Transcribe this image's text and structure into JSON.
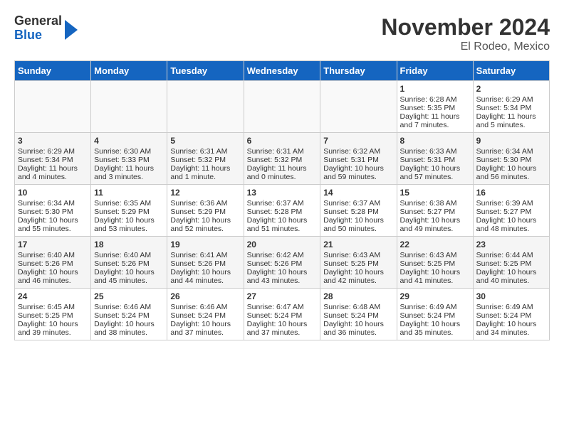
{
  "header": {
    "logo": {
      "general": "General",
      "blue": "Blue"
    },
    "title": "November 2024",
    "subtitle": "El Rodeo, Mexico"
  },
  "calendar": {
    "weekdays": [
      "Sunday",
      "Monday",
      "Tuesday",
      "Wednesday",
      "Thursday",
      "Friday",
      "Saturday"
    ],
    "weeks": [
      [
        {
          "day": "",
          "content": ""
        },
        {
          "day": "",
          "content": ""
        },
        {
          "day": "",
          "content": ""
        },
        {
          "day": "",
          "content": ""
        },
        {
          "day": "",
          "content": ""
        },
        {
          "day": "1",
          "content": "Sunrise: 6:28 AM\nSunset: 5:35 PM\nDaylight: 11 hours and 7 minutes."
        },
        {
          "day": "2",
          "content": "Sunrise: 6:29 AM\nSunset: 5:34 PM\nDaylight: 11 hours and 5 minutes."
        }
      ],
      [
        {
          "day": "3",
          "content": "Sunrise: 6:29 AM\nSunset: 5:34 PM\nDaylight: 11 hours and 4 minutes."
        },
        {
          "day": "4",
          "content": "Sunrise: 6:30 AM\nSunset: 5:33 PM\nDaylight: 11 hours and 3 minutes."
        },
        {
          "day": "5",
          "content": "Sunrise: 6:31 AM\nSunset: 5:32 PM\nDaylight: 11 hours and 1 minute."
        },
        {
          "day": "6",
          "content": "Sunrise: 6:31 AM\nSunset: 5:32 PM\nDaylight: 11 hours and 0 minutes."
        },
        {
          "day": "7",
          "content": "Sunrise: 6:32 AM\nSunset: 5:31 PM\nDaylight: 10 hours and 59 minutes."
        },
        {
          "day": "8",
          "content": "Sunrise: 6:33 AM\nSunset: 5:31 PM\nDaylight: 10 hours and 57 minutes."
        },
        {
          "day": "9",
          "content": "Sunrise: 6:34 AM\nSunset: 5:30 PM\nDaylight: 10 hours and 56 minutes."
        }
      ],
      [
        {
          "day": "10",
          "content": "Sunrise: 6:34 AM\nSunset: 5:30 PM\nDaylight: 10 hours and 55 minutes."
        },
        {
          "day": "11",
          "content": "Sunrise: 6:35 AM\nSunset: 5:29 PM\nDaylight: 10 hours and 53 minutes."
        },
        {
          "day": "12",
          "content": "Sunrise: 6:36 AM\nSunset: 5:29 PM\nDaylight: 10 hours and 52 minutes."
        },
        {
          "day": "13",
          "content": "Sunrise: 6:37 AM\nSunset: 5:28 PM\nDaylight: 10 hours and 51 minutes."
        },
        {
          "day": "14",
          "content": "Sunrise: 6:37 AM\nSunset: 5:28 PM\nDaylight: 10 hours and 50 minutes."
        },
        {
          "day": "15",
          "content": "Sunrise: 6:38 AM\nSunset: 5:27 PM\nDaylight: 10 hours and 49 minutes."
        },
        {
          "day": "16",
          "content": "Sunrise: 6:39 AM\nSunset: 5:27 PM\nDaylight: 10 hours and 48 minutes."
        }
      ],
      [
        {
          "day": "17",
          "content": "Sunrise: 6:40 AM\nSunset: 5:26 PM\nDaylight: 10 hours and 46 minutes."
        },
        {
          "day": "18",
          "content": "Sunrise: 6:40 AM\nSunset: 5:26 PM\nDaylight: 10 hours and 45 minutes."
        },
        {
          "day": "19",
          "content": "Sunrise: 6:41 AM\nSunset: 5:26 PM\nDaylight: 10 hours and 44 minutes."
        },
        {
          "day": "20",
          "content": "Sunrise: 6:42 AM\nSunset: 5:26 PM\nDaylight: 10 hours and 43 minutes."
        },
        {
          "day": "21",
          "content": "Sunrise: 6:43 AM\nSunset: 5:25 PM\nDaylight: 10 hours and 42 minutes."
        },
        {
          "day": "22",
          "content": "Sunrise: 6:43 AM\nSunset: 5:25 PM\nDaylight: 10 hours and 41 minutes."
        },
        {
          "day": "23",
          "content": "Sunrise: 6:44 AM\nSunset: 5:25 PM\nDaylight: 10 hours and 40 minutes."
        }
      ],
      [
        {
          "day": "24",
          "content": "Sunrise: 6:45 AM\nSunset: 5:25 PM\nDaylight: 10 hours and 39 minutes."
        },
        {
          "day": "25",
          "content": "Sunrise: 6:46 AM\nSunset: 5:24 PM\nDaylight: 10 hours and 38 minutes."
        },
        {
          "day": "26",
          "content": "Sunrise: 6:46 AM\nSunset: 5:24 PM\nDaylight: 10 hours and 37 minutes."
        },
        {
          "day": "27",
          "content": "Sunrise: 6:47 AM\nSunset: 5:24 PM\nDaylight: 10 hours and 37 minutes."
        },
        {
          "day": "28",
          "content": "Sunrise: 6:48 AM\nSunset: 5:24 PM\nDaylight: 10 hours and 36 minutes."
        },
        {
          "day": "29",
          "content": "Sunrise: 6:49 AM\nSunset: 5:24 PM\nDaylight: 10 hours and 35 minutes."
        },
        {
          "day": "30",
          "content": "Sunrise: 6:49 AM\nSunset: 5:24 PM\nDaylight: 10 hours and 34 minutes."
        }
      ]
    ]
  }
}
